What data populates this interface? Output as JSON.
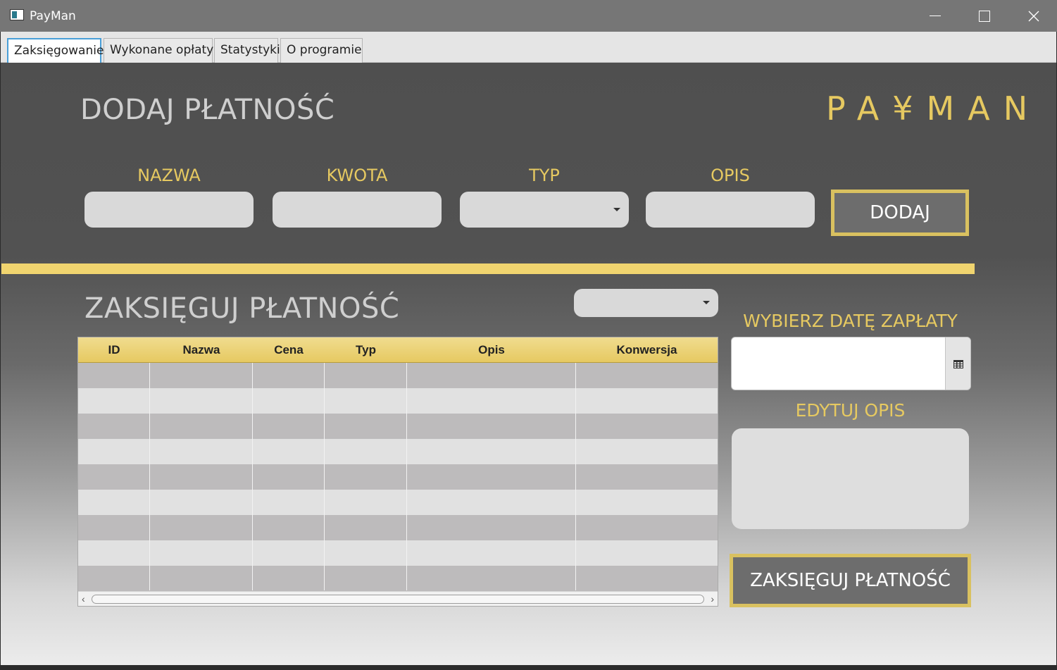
{
  "window": {
    "title": "PayMan"
  },
  "tabs": [
    {
      "label": "Zaksięgowanie",
      "active": true
    },
    {
      "label": "Wykonane opłaty",
      "active": false
    },
    {
      "label": "Statystyki",
      "active": false
    },
    {
      "label": "O programie",
      "active": false
    }
  ],
  "logo": "PA¥MAN",
  "add_section": {
    "title": "DODAJ PŁATNOŚĆ",
    "labels": {
      "name": "NAZWA",
      "amount": "KWOTA",
      "type": "TYP",
      "description": "OPIS"
    },
    "fields": {
      "name_value": "",
      "amount_value": "",
      "type_value": "",
      "description_value": ""
    },
    "add_button": "DODAJ"
  },
  "post_section": {
    "title": "ZAKSIĘGUJ PŁATNOŚĆ",
    "filter_value": "",
    "table": {
      "columns": [
        "ID",
        "Nazwa",
        "Cena",
        "Typ",
        "Opis",
        "Konwersja"
      ],
      "rows": []
    },
    "date_label": "WYBIERZ DATĘ ZAPŁATY",
    "date_value": "",
    "edit_desc_label": "EDYTUJ OPIS",
    "edit_desc_value": "",
    "post_button": "ZAKSIĘGUJ PŁATNOŚĆ"
  },
  "colors": {
    "accent": "#e6c961",
    "button_bg": "#6d6d6d",
    "tab_focus": "#4a9fd8"
  }
}
